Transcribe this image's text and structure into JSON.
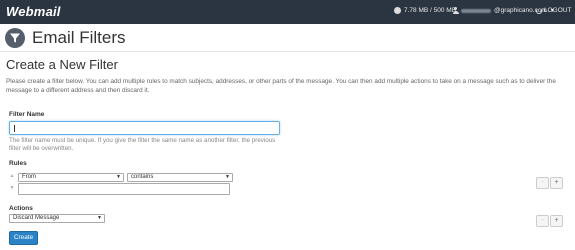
{
  "topbar": {
    "logo_text": "Webmail",
    "disk_usage": "7.78 MB / 500 MB",
    "user_email_suffix": "@graphicano.com",
    "logout_label": "LOGOUT"
  },
  "header": {
    "title": "Email Filters",
    "icon": "funnel-icon"
  },
  "form": {
    "heading": "Create a New Filter",
    "description": "Please create a filter below. You can add multiple rules to match subjects, addresses, or other parts of the message. You can then add multiple actions to take on a message such as to deliver the message to a different address and then discard it.",
    "filter_name": {
      "label": "Filter Name",
      "value": "",
      "help": "The filter name must be unique. If you give the filter the same name as another filter, the previous filter will be overwritten."
    },
    "rules": {
      "label": "Rules",
      "field_select": "From",
      "operator_select": "contains",
      "value": ""
    },
    "actions": {
      "label": "Actions",
      "action_select": "Discard Message"
    },
    "minus_label": "-",
    "plus_label": "+",
    "create_label": "Create"
  },
  "colors": {
    "topbar_bg": "#2b3541",
    "primary_button": "#2a83c6",
    "focus_border": "#66afe9"
  }
}
